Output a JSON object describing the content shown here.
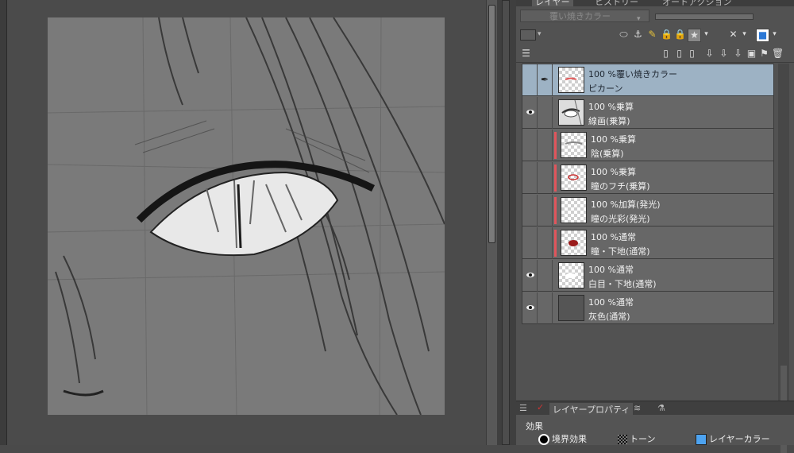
{
  "panel_tabs": [
    "レイヤー",
    "ヒストリー",
    "オートアクション"
  ],
  "blend_mode": {
    "selected": "覆い焼きカラー"
  },
  "layers": [
    {
      "opacity": "100 %覆い焼きカラー",
      "name": "ピカーン",
      "visible": false,
      "selected": true,
      "clipped": false,
      "thumb": "transparent"
    },
    {
      "opacity": "100 %乗算",
      "name": "線画(乗算)",
      "visible": true,
      "selected": false,
      "clipped": false,
      "thumb": "sketch"
    },
    {
      "opacity": "100 %乗算",
      "name": "陰(乗算)",
      "visible": false,
      "selected": false,
      "clipped": true,
      "thumb": "transparent"
    },
    {
      "opacity": "100 %乗算",
      "name": "瞳のフチ(乗算)",
      "visible": false,
      "selected": false,
      "clipped": true,
      "thumb": "transparent"
    },
    {
      "opacity": "100 %加算(発光)",
      "name": "瞳の光彩(発光)",
      "visible": false,
      "selected": false,
      "clipped": true,
      "thumb": "transparent"
    },
    {
      "opacity": "100 %通常",
      "name": "瞳・下地(通常)",
      "visible": false,
      "selected": false,
      "clipped": true,
      "thumb": "red"
    },
    {
      "opacity": "100 %通常",
      "name": "白目・下地(通常)",
      "visible": true,
      "selected": false,
      "clipped": false,
      "thumb": "transparent"
    },
    {
      "opacity": "100 %通常",
      "name": "灰色(通常)",
      "visible": true,
      "selected": false,
      "clipped": false,
      "thumb": "gray"
    }
  ],
  "property_panel": {
    "tab_label": "レイヤープロパティ",
    "effect_title": "効果",
    "effects": [
      "境界効果",
      "トーン",
      "レイヤーカラー"
    ]
  },
  "colors": {
    "selected_layer": "#9db2c4",
    "clip_bar": "#e0555c",
    "layer_color_swatch": "#4da3f0"
  }
}
